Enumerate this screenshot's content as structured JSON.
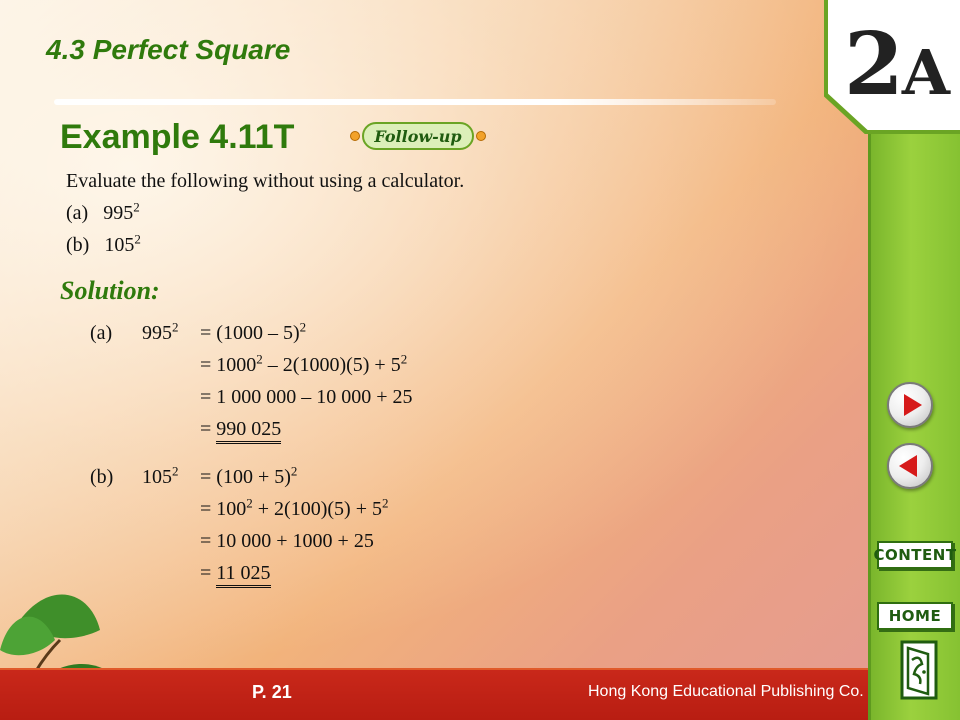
{
  "header": {
    "section_title": "4.3 Perfect Square",
    "example_title": "Example 4.11T",
    "followup_label": "Follow-up"
  },
  "book_label": {
    "num": "2",
    "letter": "A"
  },
  "question": {
    "prompt": "Evaluate the following without using a calculator.",
    "parts": [
      {
        "label": "(a)",
        "base": "995",
        "exp": "2"
      },
      {
        "label": "(b)",
        "base": "105",
        "exp": "2"
      }
    ]
  },
  "solution": {
    "label": "Solution:",
    "a": {
      "label": "(a)",
      "lhs_base": "995",
      "lhs_exp": "2",
      "line1": {
        "pre": "= (1000 – 5)",
        "exp": "2"
      },
      "line2": {
        "p1": "= 1000",
        "e1": "2",
        "p2": " – 2(1000)(5) + 5",
        "e2": "2"
      },
      "line3": "= 1 000 000 – 10 000 + 25",
      "line4_eq": "= ",
      "answer": "990 025"
    },
    "b": {
      "label": "(b)",
      "lhs_base": "105",
      "lhs_exp": "2",
      "line1": {
        "pre": "= (100 + 5)",
        "exp": "2"
      },
      "line2": {
        "p1": "= 100",
        "e1": "2",
        "p2": " + 2(100)(5) + 5",
        "e2": "2"
      },
      "line3": "= 10 000 + 1000 + 25",
      "line4_eq": "= ",
      "answer": "11 025"
    }
  },
  "nav": {
    "next_icon": "play-right-icon",
    "prev_icon": "play-left-icon",
    "content_label": "CONTENT",
    "home_label": "HOME",
    "exit_icon": "exit-door-icon"
  },
  "footer": {
    "page": "P. 21",
    "publisher": "Hong Kong Educational Publishing Co."
  },
  "colors": {
    "title_green": "#2f7a0c",
    "sidebar_green": "#9bd13e",
    "footer_red": "#c9281a",
    "arrow_red": "#d61a1a"
  }
}
